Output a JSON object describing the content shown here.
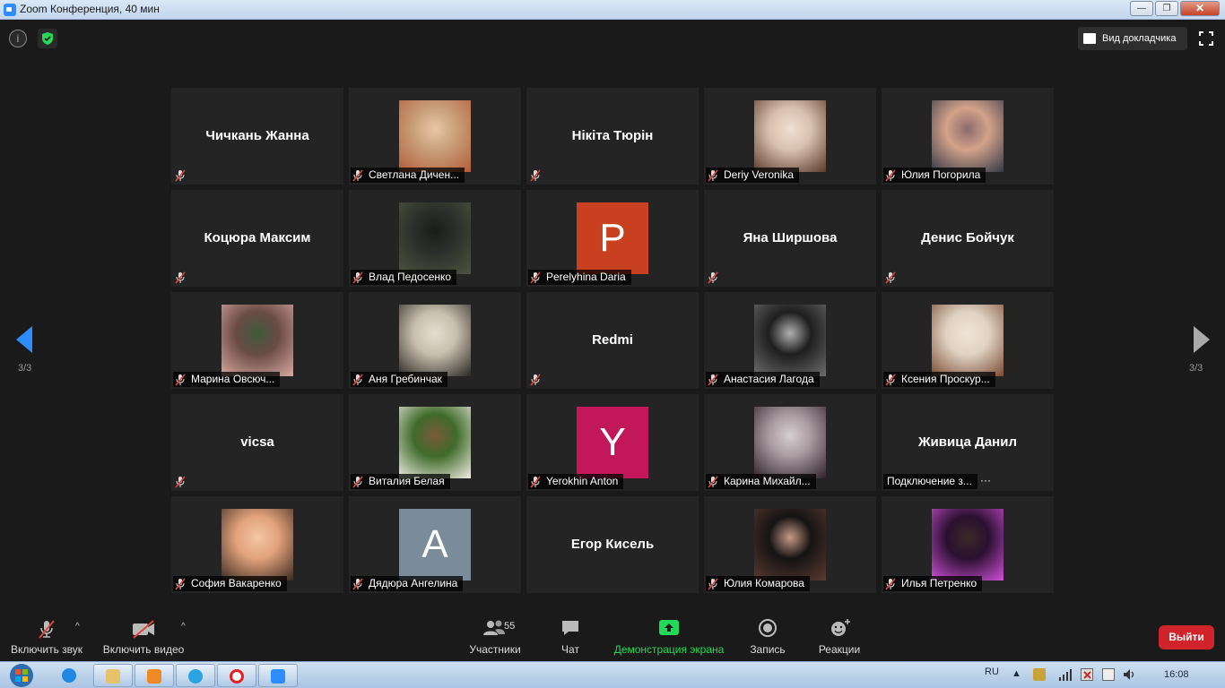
{
  "window": {
    "title": "Zoom Конференция, 40 мин"
  },
  "top_bar": {
    "speaker_view_label": "Вид докладчика"
  },
  "pages": {
    "left_indicator": "3/3",
    "right_indicator": "3/3"
  },
  "participants": [
    {
      "name": "Чичкань Жанна",
      "display": "name"
    },
    {
      "name": "Светлана Дичен...",
      "display": "photo",
      "photo_colors": [
        "#c9a07a",
        "#b35b3b",
        "#e8c8a8"
      ]
    },
    {
      "name": "Нікіта Тюрін",
      "display": "name"
    },
    {
      "name": "Deriy Veronika",
      "display": "photo",
      "photo_colors": [
        "#d9c0ae",
        "#5a3a2b",
        "#efdfd2"
      ]
    },
    {
      "name": "Юлия Погорила",
      "display": "photo",
      "photo_colors": [
        "#d3a28a",
        "#333846",
        "#8c6b6b"
      ]
    },
    {
      "name": "Коцюра Максим",
      "display": "name"
    },
    {
      "name": "Влад Педосенко",
      "display": "photo",
      "photo_colors": [
        "#2b2f2a",
        "#4d5440",
        "#1a1c1a"
      ]
    },
    {
      "name": "Perelyhina Daria",
      "display": "letter",
      "letter": "P",
      "color": "#c8401f"
    },
    {
      "name": "Яна Ширшова",
      "display": "name"
    },
    {
      "name": "Денис Бойчук",
      "display": "name"
    },
    {
      "name": "Марина Овсюч...",
      "display": "photo",
      "photo_colors": [
        "#6a4a46",
        "#d7a9a0",
        "#3e5c3a"
      ]
    },
    {
      "name": "Аня Гребинчак",
      "display": "photo",
      "photo_colors": [
        "#c9bfae",
        "#2a2724",
        "#e6ddd0"
      ]
    },
    {
      "name": "Redmi",
      "display": "name"
    },
    {
      "name": "Анастасия Лагода",
      "display": "photo",
      "photo_colors": [
        "#1e1e1e",
        "#6e6e6e",
        "#b0b0b0"
      ]
    },
    {
      "name": "Ксения Проскур...",
      "display": "photo",
      "photo_colors": [
        "#e0d3c4",
        "#7a4a32",
        "#f0e4d6"
      ]
    },
    {
      "name": "vicsa",
      "display": "name"
    },
    {
      "name": "Виталия Белая",
      "display": "photo",
      "photo_colors": [
        "#3f6b2a",
        "#f0ece4",
        "#7a5a3a"
      ]
    },
    {
      "name": "Yerokhin Anton",
      "display": "letter",
      "letter": "Y",
      "color": "#c2185b"
    },
    {
      "name": "Карина Михайл...",
      "display": "photo",
      "photo_colors": [
        "#a99aa0",
        "#2e2228",
        "#d6cfd2"
      ]
    },
    {
      "name": "Живица Данил",
      "display": "name",
      "label": "Подключение з...",
      "connecting": true
    },
    {
      "name": "София Вакаренко",
      "display": "photo",
      "photo_colors": [
        "#e2a27c",
        "#3a2a22",
        "#f2c7a2"
      ]
    },
    {
      "name": "Дядюра Ангелина",
      "display": "letter",
      "letter": "A",
      "color": "#7a8c99"
    },
    {
      "name": "Егор Кисель",
      "display": "name",
      "no_label": true
    },
    {
      "name": "Юлия Комарова",
      "display": "photo",
      "photo_colors": [
        "#151313",
        "#5a3a30",
        "#c89a88"
      ]
    },
    {
      "name": "Илья Петренко",
      "display": "photo",
      "photo_colors": [
        "#2a1030",
        "#d050d8",
        "#3a2a28"
      ]
    }
  ],
  "toolbar": {
    "audio_label": "Включить звук",
    "video_label": "Включить видео",
    "participants_label": "Участники",
    "participants_count": "55",
    "chat_label": "Чат",
    "share_label": "Демонстрация экрана",
    "record_label": "Запись",
    "reactions_label": "Реакции",
    "exit_label": "Выйти"
  },
  "taskbar": {
    "lang": "RU",
    "time": "16:08"
  },
  "colors": {
    "share_green": "#23d959",
    "exit_red": "#d1232a",
    "nav_blue": "#2d8cff",
    "muted_red": "#e0453a"
  }
}
